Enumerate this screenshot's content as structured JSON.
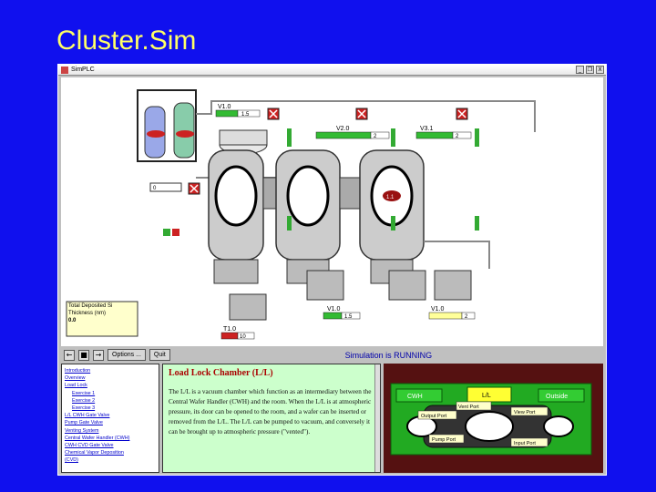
{
  "slide": {
    "title": "Cluster.Sim"
  },
  "window": {
    "title": "SimPLC",
    "buttons": [
      "_",
      "❐",
      "X"
    ]
  },
  "sim": {
    "gauges": [
      {
        "label": "V1.0",
        "value": "1.5"
      },
      {
        "label": "V2.0",
        "value": "2"
      },
      {
        "label": "V3.1",
        "value": "2"
      },
      {
        "label": "V1.0",
        "value": "1.5"
      },
      {
        "label": "V1.0",
        "value": "2"
      },
      {
        "label": "T1.0",
        "value": "10"
      }
    ],
    "left_input": "0",
    "chamber_badge": "1.1",
    "thickness_label": "Total Deposited Si Thickness (nm)",
    "thickness_value": "0.0"
  },
  "toolbar": {
    "icons": [
      "←",
      "■",
      "→"
    ],
    "options_label": "Options ...",
    "quit_label": "Quit",
    "status": "Simulation is RUNNING"
  },
  "nav": {
    "items": [
      {
        "label": "Introduction",
        "sub": false
      },
      {
        "label": "Overview",
        "sub": false
      },
      {
        "label": "Load Lock",
        "sub": false
      },
      {
        "label": "Exercise 1",
        "sub": true
      },
      {
        "label": "Exercise 2",
        "sub": true
      },
      {
        "label": "Exercise 3",
        "sub": true
      },
      {
        "label": "L/L CWH Gate Valve",
        "sub": false
      },
      {
        "label": "Pump Gate Valve",
        "sub": false
      },
      {
        "label": "Venting System",
        "sub": false
      },
      {
        "label": "Central Wafer Handler (CWH)",
        "sub": false
      },
      {
        "label": "CWH CVD Gate Valve",
        "sub": false
      },
      {
        "label": "Chemical Vapor Deposition",
        "sub": false
      },
      {
        "label": "(CVD)",
        "sub": false
      }
    ]
  },
  "info": {
    "title": "Load Lock Chamber (L/L)",
    "body": "The L/L is a vacuum chamber which function as an intermediary between the Central Wafer Handler (CWH) and the room. When the L/L is at atmospheric pressure, its door can be opened to the room, and a wafer can be inserted or removed from the L/L. The L/L can be pumped to vacuum, and conversely it can be brought up to atmospheric pressure (\"vented\")."
  },
  "picture": {
    "labels": {
      "cwh": "CWH",
      "ll": "L/L",
      "outside": "Outside",
      "vent_port": "Vent Port",
      "view_port": "View Port",
      "output_port": "Output Port",
      "pump_port": "Pump Port",
      "input_port": "Input Port"
    }
  }
}
